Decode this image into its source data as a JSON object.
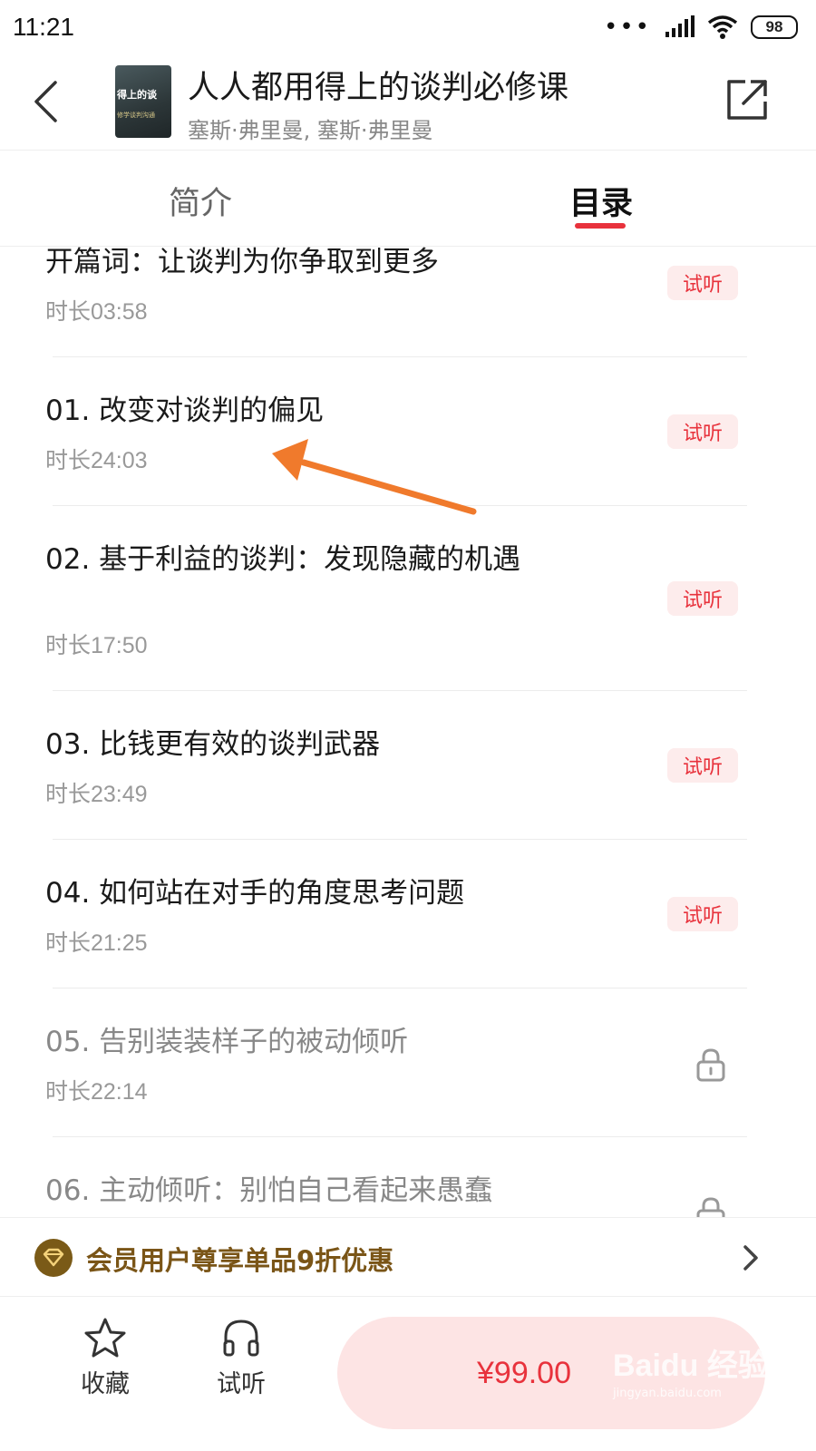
{
  "status_bar": {
    "time": "11:21",
    "battery": "98"
  },
  "header": {
    "title": "人人都用得上的谈判必修课",
    "author": "塞斯·弗里曼, 塞斯·弗里曼",
    "cover": {
      "title": "得上的谈",
      "subtitle": "修学谈判沟通"
    }
  },
  "tabs": [
    {
      "label": "简介",
      "active": false
    },
    {
      "label": "目录",
      "active": true
    }
  ],
  "accent_color": "#e8323c",
  "episodes": [
    {
      "title": "开篇词：让谈判为你争取到更多",
      "duration": "时长03:58",
      "status": "试听"
    },
    {
      "title": "01. 改变对谈判的偏见",
      "duration": "时长24:03",
      "status": "试听"
    },
    {
      "title": "02. 基于利益的谈判：发现隐藏的机遇",
      "duration": "时长17:50",
      "status": "试听"
    },
    {
      "title": "03. 比钱更有效的谈判武器",
      "duration": "时长23:49",
      "status": "试听"
    },
    {
      "title": "04. 如何站在对手的角度思考问题",
      "duration": "时长21:25",
      "status": "试听"
    },
    {
      "title": "05. 告别装装样子的被动倾听",
      "duration": "时长22:14",
      "status": "locked"
    },
    {
      "title": "06. 主动倾听：别怕自己看起来愚蠢",
      "duration": "",
      "status": "locked"
    }
  ],
  "member_banner": {
    "text": "会员用户尊享单品9折优惠"
  },
  "bottom_bar": {
    "favorite_label": "收藏",
    "listen_label": "试听",
    "price": "¥99.00"
  },
  "watermark": {
    "main": "Baidu 经验",
    "sub": "jingyan.baidu.com"
  }
}
